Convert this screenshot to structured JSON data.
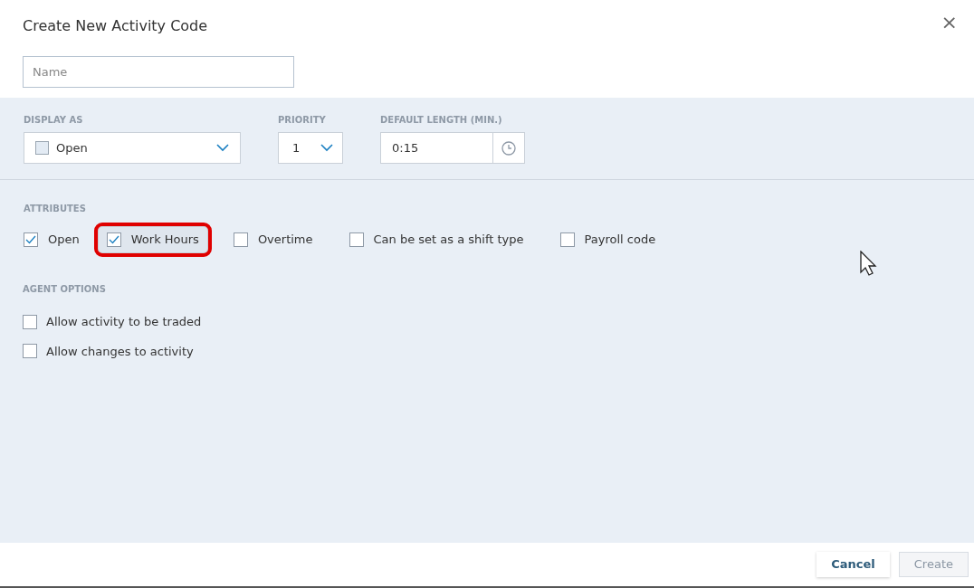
{
  "dialog": {
    "title": "Create New Activity Code",
    "close": "×"
  },
  "name_field": {
    "placeholder": "Name"
  },
  "display_as": {
    "label": "DISPLAY AS",
    "value": "Open"
  },
  "priority": {
    "label": "PRIORITY",
    "value": "1"
  },
  "default_length": {
    "label": "DEFAULT LENGTH (MIN.)",
    "value": "0:15"
  },
  "attributes": {
    "label": "ATTRIBUTES",
    "items": [
      {
        "label": "Open",
        "checked": true,
        "highlighted": false
      },
      {
        "label": "Work Hours",
        "checked": true,
        "highlighted": true
      },
      {
        "label": "Overtime",
        "checked": false,
        "highlighted": false
      },
      {
        "label": "Can be set as a shift type",
        "checked": false,
        "highlighted": false
      },
      {
        "label": "Payroll code",
        "checked": false,
        "highlighted": false
      }
    ]
  },
  "agent_options": {
    "label": "AGENT OPTIONS",
    "items": [
      {
        "label": "Allow activity to be traded",
        "checked": false
      },
      {
        "label": "Allow changes to activity",
        "checked": false
      }
    ]
  },
  "buttons": [
    {
      "label": "Cancel",
      "disabled": false
    },
    {
      "label": "Create",
      "disabled": true
    }
  ]
}
